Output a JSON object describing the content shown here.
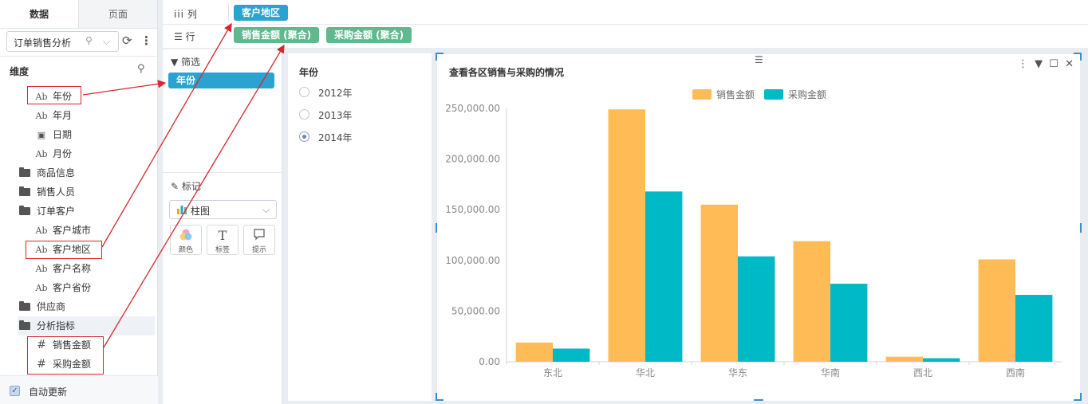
{
  "left_panel": {
    "tabs": [
      "数据",
      "页面"
    ],
    "dataset_name": "订单销售分析",
    "dimensions_header": "维度",
    "tree": [
      {
        "label": "年份",
        "icon": "Ab",
        "level": 2
      },
      {
        "label": "年月",
        "icon": "Ab",
        "level": 2
      },
      {
        "label": "日期",
        "icon": "date",
        "level": 2
      },
      {
        "label": "月份",
        "icon": "Ab",
        "level": 2
      },
      {
        "label": "商品信息",
        "icon": "folder",
        "level": 1
      },
      {
        "label": "销售人员",
        "icon": "folder",
        "level": 1
      },
      {
        "label": "订单客户",
        "icon": "folder-open",
        "level": 1
      },
      {
        "label": "客户城市",
        "icon": "Ab",
        "level": 2
      },
      {
        "label": "客户地区",
        "icon": "Ab",
        "level": 2
      },
      {
        "label": "客户名称",
        "icon": "Ab",
        "level": 2
      },
      {
        "label": "客户省份",
        "icon": "Ab",
        "level": 2
      },
      {
        "label": "供应商",
        "icon": "folder",
        "level": 1
      },
      {
        "label": "分析指标",
        "icon": "folder-open",
        "level": 1
      },
      {
        "label": "销售金额",
        "icon": "#",
        "level": 2
      },
      {
        "label": "采购金额",
        "icon": "#",
        "level": 2
      }
    ],
    "auto_update_label": "自动更新"
  },
  "shelves": {
    "columns_label": "列",
    "rows_label": "行",
    "column_pill": "客户地区",
    "row_pills": [
      "销售金额 (聚合)",
      "采购金额 (聚合)"
    ]
  },
  "filter_panel": {
    "title": "筛选",
    "pill": "年份"
  },
  "marks_panel": {
    "title": "标记",
    "mark_type": "柱图",
    "buttons": [
      "颜色",
      "标签",
      "提示"
    ]
  },
  "year_filter": {
    "title": "年份",
    "options": [
      "2012年",
      "2013年",
      "2014年"
    ],
    "selected": "2014年"
  },
  "colors": {
    "sales": "#ffbb55",
    "purchase": "#00b9c6",
    "accent": "#2aa3d0",
    "pill_green": "#5fb88e",
    "highlight_red": "#d9272e"
  },
  "chart_data": {
    "type": "bar",
    "title": "查看各区销售与采购的情况",
    "categories": [
      "东北",
      "华北",
      "华东",
      "华南",
      "西北",
      "西南"
    ],
    "series": [
      {
        "name": "销售金额",
        "values": [
          19000,
          249000,
          155000,
          119000,
          5000,
          101000
        ]
      },
      {
        "name": "采购金额",
        "values": [
          13000,
          168000,
          104000,
          77000,
          3500,
          66000
        ]
      }
    ],
    "ylim": [
      0,
      250000
    ],
    "yticks": [
      "0.00",
      "50,000.00",
      "100,000.00",
      "150,000.00",
      "200,000.00",
      "250,000.00"
    ],
    "legend": "top-center",
    "grid": false
  }
}
